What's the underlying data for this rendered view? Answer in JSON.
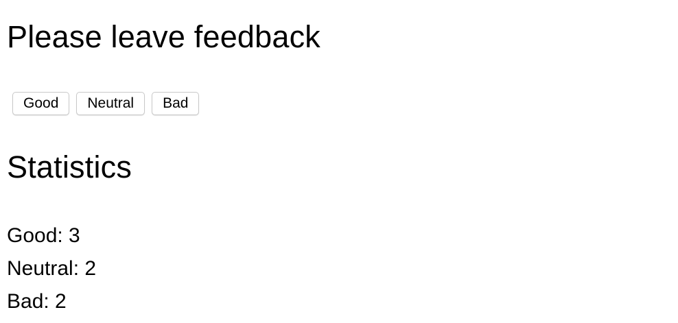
{
  "feedback": {
    "title": "Please leave feedback",
    "buttons": {
      "good_label": "Good",
      "neutral_label": "Neutral",
      "bad_label": "Bad"
    }
  },
  "statistics": {
    "title": "Statistics",
    "good": "Good: 3",
    "neutral": "Neutral: 2",
    "bad": "Bad: 2"
  }
}
